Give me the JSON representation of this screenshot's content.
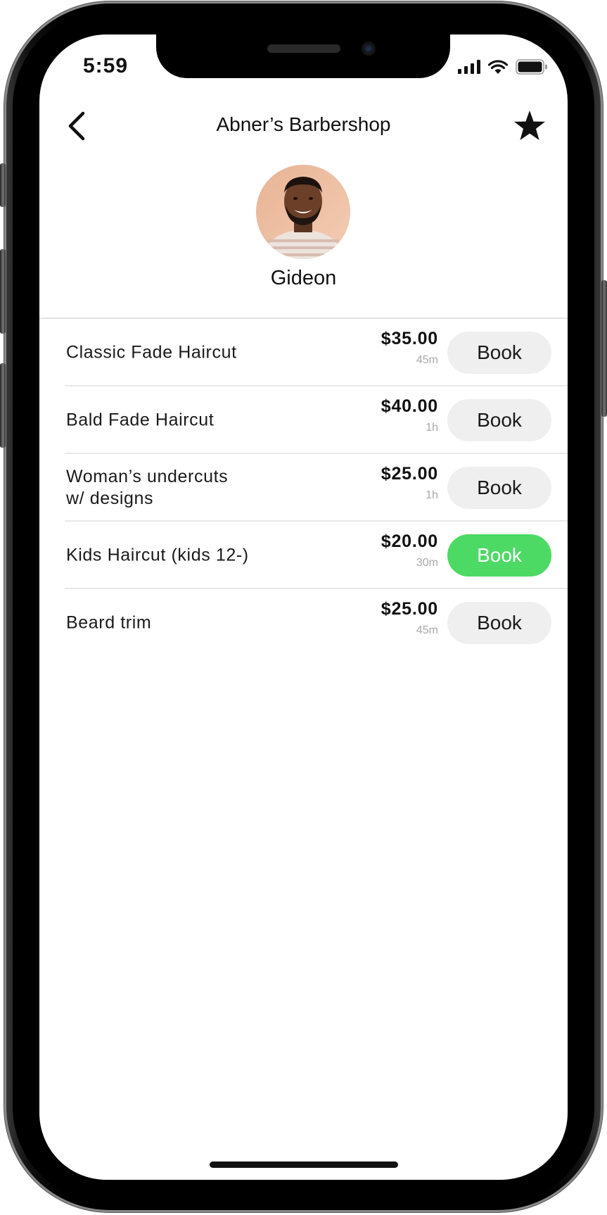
{
  "status_bar": {
    "time": "5:59",
    "icons": [
      "cellular-signal-icon",
      "wifi-icon",
      "battery-icon"
    ]
  },
  "header": {
    "title": "Abner’s Barbershop",
    "back_icon": "chevron-left-icon",
    "favorite_icon": "star-icon"
  },
  "profile": {
    "name": "Gideon",
    "avatar": "barber-avatar-photo"
  },
  "services": [
    {
      "name": "Classic Fade Haircut",
      "price": "$35.00",
      "duration": "45m",
      "button_label": "Book",
      "active": false
    },
    {
      "name": "Bald Fade Haircut",
      "price": "$40.00",
      "duration": "1h",
      "button_label": "Book",
      "active": false
    },
    {
      "name": "Woman’s undercuts\nw/ designs",
      "price": "$25.00",
      "duration": "1h",
      "button_label": "Book",
      "active": false
    },
    {
      "name": "Kids Haircut (kids 12-)",
      "price": "$20.00",
      "duration": "30m",
      "button_label": "Book",
      "active": true
    },
    {
      "name": "Beard trim",
      "price": "$25.00",
      "duration": "45m",
      "button_label": "Book",
      "active": false
    }
  ],
  "colors": {
    "active_button": "#4cd964",
    "inactive_button": "#efefef",
    "duration_text": "#a8a8a8"
  }
}
